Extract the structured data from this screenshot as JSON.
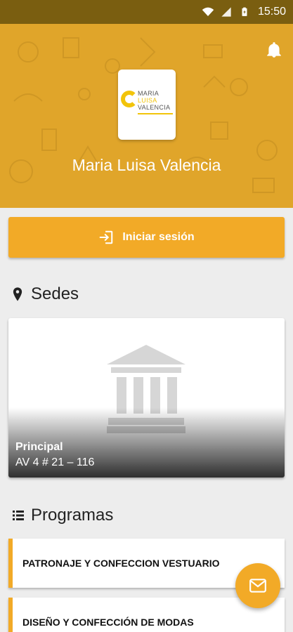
{
  "status_bar": {
    "time": "15:50",
    "icons": [
      "wifi-icon",
      "cell-signal-icon",
      "battery-icon"
    ]
  },
  "header": {
    "institution_name": "Maria Luisa Valencia",
    "logo": {
      "line1": "MARIA",
      "line2": "LUISA",
      "line3": "VALENCIA"
    },
    "notification_icon": "bell-icon"
  },
  "login": {
    "label": "Iniciar sesión",
    "icon": "login-icon"
  },
  "sedes": {
    "title": "Sedes",
    "icon": "location-pin-icon",
    "items": [
      {
        "name": "Principal",
        "address": "AV 4 # 21 – 116",
        "image_icon": "building-columns-icon"
      }
    ]
  },
  "programas": {
    "title": "Programas",
    "icon": "list-icon",
    "items": [
      {
        "label": "PATRONAJE Y CONFECCION VESTUARIO"
      },
      {
        "label": "DISEÑO Y CONFECCIÓN DE MODAS"
      }
    ]
  },
  "fab": {
    "icon": "mail-icon"
  },
  "colors": {
    "accent": "#f2aa27",
    "header_bg": "#e0a52a",
    "status_bar": "#7a5e10",
    "background": "#ededed"
  }
}
